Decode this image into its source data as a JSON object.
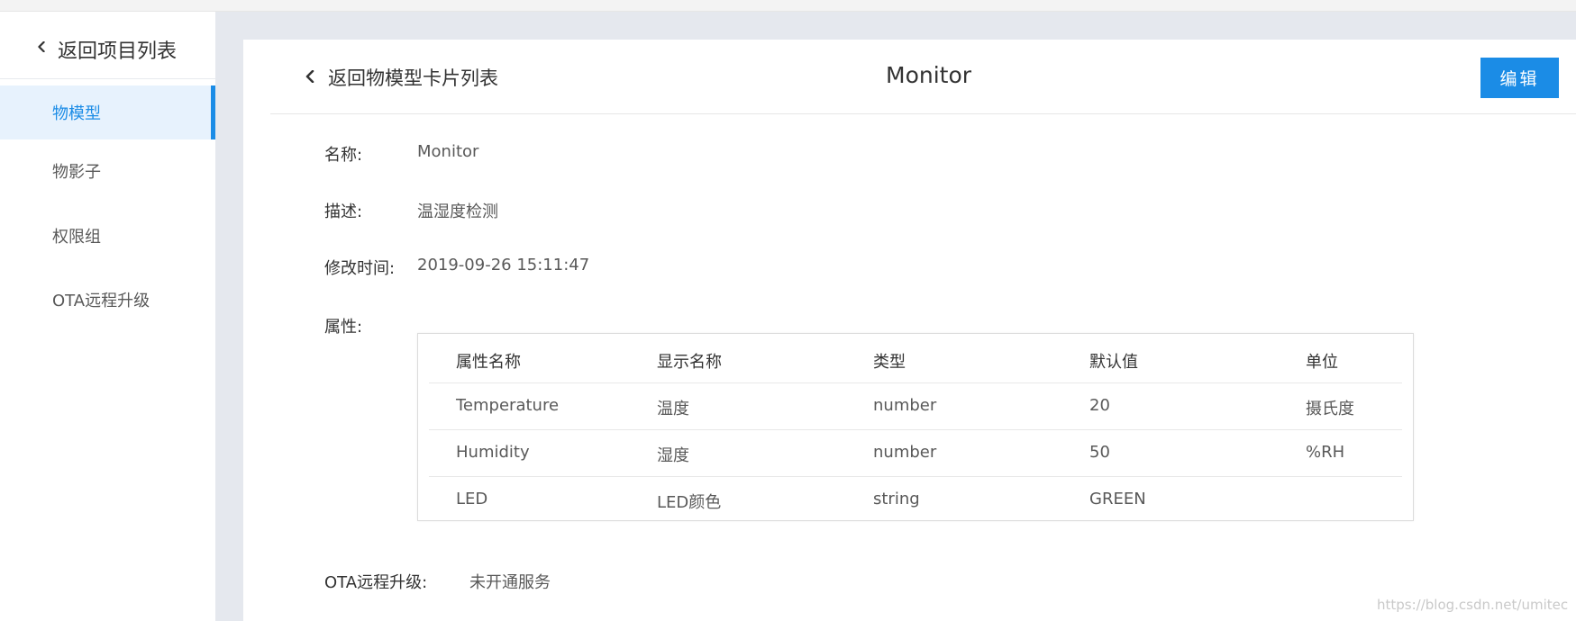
{
  "sidebar": {
    "back_label": "返回项目列表",
    "items": [
      {
        "label": "物模型",
        "active": true
      },
      {
        "label": "物影子",
        "active": false
      },
      {
        "label": "权限组",
        "active": false
      },
      {
        "label": "OTA远程升级",
        "active": false
      }
    ]
  },
  "header": {
    "back_label": "返回物模型卡片列表",
    "title": "Monitor",
    "edit_label": "编辑"
  },
  "details": {
    "name_label": "名称:",
    "name_value": "Monitor",
    "desc_label": "描述:",
    "desc_value": "温湿度检测",
    "modified_label": "修改时间:",
    "modified_value": "2019-09-26 15:11:47",
    "props_label": "属性:",
    "ota_label": "OTA远程升级:",
    "ota_value": "未开通服务"
  },
  "properties": {
    "columns": [
      "属性名称",
      "显示名称",
      "类型",
      "默认值",
      "单位"
    ],
    "rows": [
      [
        "Temperature",
        "温度",
        "number",
        "20",
        "摄氏度"
      ],
      [
        "Humidity",
        "湿度",
        "number",
        "50",
        "%RH"
      ],
      [
        "LED",
        "LED颜色",
        "string",
        "GREEN",
        ""
      ]
    ]
  },
  "watermark": "https://blog.csdn.net/umitec",
  "colors": {
    "accent": "#1b8ce6",
    "active_bg": "#e7f2fd",
    "page_bg": "#e5e8ee"
  },
  "icons": {
    "sidebar_back": "chevron-left-icon",
    "header_back": "chevron-left-icon"
  }
}
